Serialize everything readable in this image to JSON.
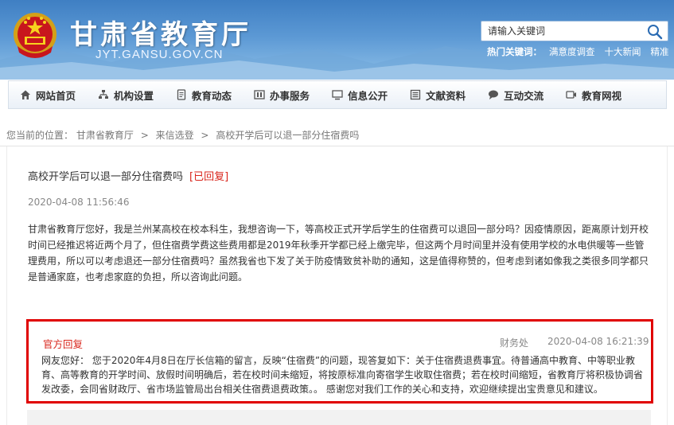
{
  "header": {
    "title": "甘肃省教育厅",
    "domain": "JYT.GANSU.GOV.CN",
    "search_placeholder": "请输入关键词",
    "hot_label": "热门关键词：",
    "hot_keywords": [
      "满意度调查",
      "十大新闻",
      "精准"
    ]
  },
  "nav": {
    "items": [
      {
        "label": "网站首页",
        "icon": "home-icon"
      },
      {
        "label": "机构设置",
        "icon": "org-chart-icon"
      },
      {
        "label": "教育动态",
        "icon": "document-icon"
      },
      {
        "label": "办事服务",
        "icon": "building-icon"
      },
      {
        "label": "信息公开",
        "icon": "monitor-icon"
      },
      {
        "label": "文献资料",
        "icon": "list-icon"
      },
      {
        "label": "互动交流",
        "icon": "chat-icon"
      },
      {
        "label": "教育网视",
        "icon": "video-icon"
      }
    ]
  },
  "breadcrumb": {
    "prefix": "您当前的位置：",
    "items": [
      "甘肃省教育厅",
      "来信选登",
      "高校开学后可以退一部分住宿费吗"
    ],
    "separator": ">"
  },
  "letter": {
    "title": "高校开学后可以退一部分住宿费吗",
    "status": "[已回复]",
    "date": "2020-04-08 11:56:46",
    "body": "甘肃省教育厅您好，我是兰州某高校在校本科生，我想咨询一下，等高校正式开学后学生的住宿费可以退回一部分吗？因疫情原因，距离原计划开校时间已经推迟将近两个月了，但住宿费学费这些费用都是2019年秋季开学都已经上缴完毕，但这两个月时间里并没有使用学校的水电供暖等一些管理费用，所以可以考虑退还一部分住宿费吗？虽然我省也下发了关于防疫情致贫补助的通知，这是值得称赞的，但考虑到诸如像我之类很多同学都只是普通家庭，也考虑家庭的负担，所以咨询此问题。"
  },
  "reply": {
    "label": "官方回复",
    "department": "财务处",
    "date": "2020-04-08 16:21:39",
    "body": "网友您好： 您于2020年4月8日在厅长信箱的留言，反映“住宿费”的问题，现答复如下：关于住宿费退费事宜。待普通高中教育、中等职业教育、高等教育的开学时间、放假时间明确后，若在校时间未缩短，将按原标准向寄宿学生收取住宿费；若在校时间缩短，省教育厅将积极协调省发改委，会同省财政厅、省市场监管局出台相关住宿费退费政策。。 感谢您对我们工作的关心和支持，欢迎继续提出宝贵意见和建议。"
  },
  "colors": {
    "header_blue": "#3f7fc3",
    "status_red": "#d9261c",
    "highlight_border": "#e00000"
  }
}
